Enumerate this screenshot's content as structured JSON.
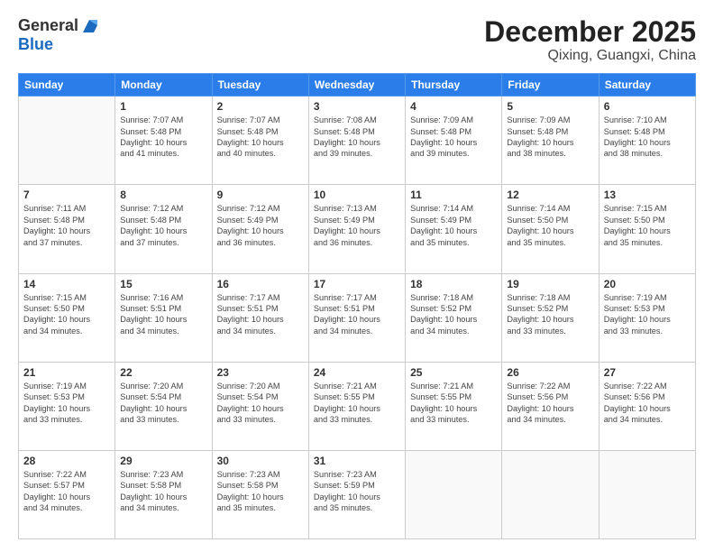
{
  "logo": {
    "general": "General",
    "blue": "Blue"
  },
  "header": {
    "month": "December 2025",
    "location": "Qixing, Guangxi, China"
  },
  "weekdays": [
    "Sunday",
    "Monday",
    "Tuesday",
    "Wednesday",
    "Thursday",
    "Friday",
    "Saturday"
  ],
  "weeks": [
    [
      {
        "day": "",
        "info": ""
      },
      {
        "day": "1",
        "info": "Sunrise: 7:07 AM\nSunset: 5:48 PM\nDaylight: 10 hours\nand 41 minutes."
      },
      {
        "day": "2",
        "info": "Sunrise: 7:07 AM\nSunset: 5:48 PM\nDaylight: 10 hours\nand 40 minutes."
      },
      {
        "day": "3",
        "info": "Sunrise: 7:08 AM\nSunset: 5:48 PM\nDaylight: 10 hours\nand 39 minutes."
      },
      {
        "day": "4",
        "info": "Sunrise: 7:09 AM\nSunset: 5:48 PM\nDaylight: 10 hours\nand 39 minutes."
      },
      {
        "day": "5",
        "info": "Sunrise: 7:09 AM\nSunset: 5:48 PM\nDaylight: 10 hours\nand 38 minutes."
      },
      {
        "day": "6",
        "info": "Sunrise: 7:10 AM\nSunset: 5:48 PM\nDaylight: 10 hours\nand 38 minutes."
      }
    ],
    [
      {
        "day": "7",
        "info": "Sunrise: 7:11 AM\nSunset: 5:48 PM\nDaylight: 10 hours\nand 37 minutes."
      },
      {
        "day": "8",
        "info": "Sunrise: 7:12 AM\nSunset: 5:48 PM\nDaylight: 10 hours\nand 37 minutes."
      },
      {
        "day": "9",
        "info": "Sunrise: 7:12 AM\nSunset: 5:49 PM\nDaylight: 10 hours\nand 36 minutes."
      },
      {
        "day": "10",
        "info": "Sunrise: 7:13 AM\nSunset: 5:49 PM\nDaylight: 10 hours\nand 36 minutes."
      },
      {
        "day": "11",
        "info": "Sunrise: 7:14 AM\nSunset: 5:49 PM\nDaylight: 10 hours\nand 35 minutes."
      },
      {
        "day": "12",
        "info": "Sunrise: 7:14 AM\nSunset: 5:50 PM\nDaylight: 10 hours\nand 35 minutes."
      },
      {
        "day": "13",
        "info": "Sunrise: 7:15 AM\nSunset: 5:50 PM\nDaylight: 10 hours\nand 35 minutes."
      }
    ],
    [
      {
        "day": "14",
        "info": "Sunrise: 7:15 AM\nSunset: 5:50 PM\nDaylight: 10 hours\nand 34 minutes."
      },
      {
        "day": "15",
        "info": "Sunrise: 7:16 AM\nSunset: 5:51 PM\nDaylight: 10 hours\nand 34 minutes."
      },
      {
        "day": "16",
        "info": "Sunrise: 7:17 AM\nSunset: 5:51 PM\nDaylight: 10 hours\nand 34 minutes."
      },
      {
        "day": "17",
        "info": "Sunrise: 7:17 AM\nSunset: 5:51 PM\nDaylight: 10 hours\nand 34 minutes."
      },
      {
        "day": "18",
        "info": "Sunrise: 7:18 AM\nSunset: 5:52 PM\nDaylight: 10 hours\nand 34 minutes."
      },
      {
        "day": "19",
        "info": "Sunrise: 7:18 AM\nSunset: 5:52 PM\nDaylight: 10 hours\nand 33 minutes."
      },
      {
        "day": "20",
        "info": "Sunrise: 7:19 AM\nSunset: 5:53 PM\nDaylight: 10 hours\nand 33 minutes."
      }
    ],
    [
      {
        "day": "21",
        "info": "Sunrise: 7:19 AM\nSunset: 5:53 PM\nDaylight: 10 hours\nand 33 minutes."
      },
      {
        "day": "22",
        "info": "Sunrise: 7:20 AM\nSunset: 5:54 PM\nDaylight: 10 hours\nand 33 minutes."
      },
      {
        "day": "23",
        "info": "Sunrise: 7:20 AM\nSunset: 5:54 PM\nDaylight: 10 hours\nand 33 minutes."
      },
      {
        "day": "24",
        "info": "Sunrise: 7:21 AM\nSunset: 5:55 PM\nDaylight: 10 hours\nand 33 minutes."
      },
      {
        "day": "25",
        "info": "Sunrise: 7:21 AM\nSunset: 5:55 PM\nDaylight: 10 hours\nand 33 minutes."
      },
      {
        "day": "26",
        "info": "Sunrise: 7:22 AM\nSunset: 5:56 PM\nDaylight: 10 hours\nand 34 minutes."
      },
      {
        "day": "27",
        "info": "Sunrise: 7:22 AM\nSunset: 5:56 PM\nDaylight: 10 hours\nand 34 minutes."
      }
    ],
    [
      {
        "day": "28",
        "info": "Sunrise: 7:22 AM\nSunset: 5:57 PM\nDaylight: 10 hours\nand 34 minutes."
      },
      {
        "day": "29",
        "info": "Sunrise: 7:23 AM\nSunset: 5:58 PM\nDaylight: 10 hours\nand 34 minutes."
      },
      {
        "day": "30",
        "info": "Sunrise: 7:23 AM\nSunset: 5:58 PM\nDaylight: 10 hours\nand 35 minutes."
      },
      {
        "day": "31",
        "info": "Sunrise: 7:23 AM\nSunset: 5:59 PM\nDaylight: 10 hours\nand 35 minutes."
      },
      {
        "day": "",
        "info": ""
      },
      {
        "day": "",
        "info": ""
      },
      {
        "day": "",
        "info": ""
      }
    ]
  ]
}
